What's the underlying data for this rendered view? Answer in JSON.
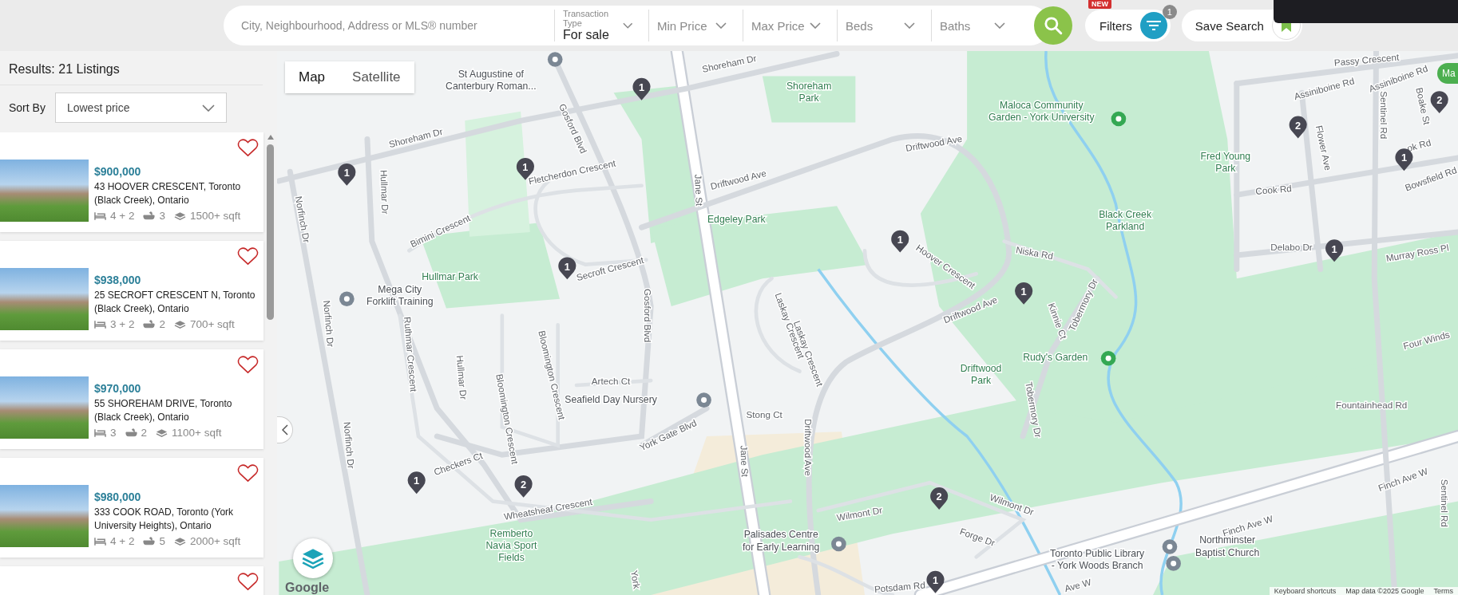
{
  "search": {
    "placeholder": "City, Neighbourhood, Address or MLS® number"
  },
  "filters": [
    {
      "label": "Transaction Type",
      "value": "For sale"
    },
    {
      "placeholder": "Min Price"
    },
    {
      "placeholder": "Max Price"
    },
    {
      "placeholder": "Beds"
    },
    {
      "placeholder": "Baths"
    }
  ],
  "filters_button": {
    "label": "Filters",
    "badge": "NEW",
    "count": "1"
  },
  "save_search_button": {
    "label": "Save Search"
  },
  "results": {
    "title": "Results:  21 Listings",
    "sort_label": "Sort By",
    "sort_value": "Lowest price"
  },
  "listings": [
    {
      "price": "$900,000",
      "address": "43 HOOVER CRESCENT, Toronto (Black Creek), Ontario",
      "beds": "4 + 2",
      "baths": "3",
      "size": "1500+ sqft",
      "favorite": false
    },
    {
      "price": "$938,000",
      "address": "25 SECROFT CRESCENT N, Toronto (Black Creek), Ontario",
      "beds": "3 + 2",
      "baths": "2",
      "size": "700+ sqft",
      "favorite": false
    },
    {
      "price": "$970,000",
      "address": "55 SHOREHAM DRIVE, Toronto (Black Creek), Ontario",
      "beds": "3",
      "baths": "2",
      "size": "1100+ sqft",
      "favorite": false
    },
    {
      "price": "$980,000",
      "address": "333 COOK ROAD, Toronto (York University Heights), Ontario",
      "beds": "4 + 2",
      "baths": "5",
      "size": "2000+ sqft",
      "favorite": false
    },
    {
      "favorite": false
    }
  ],
  "map": {
    "tabs": [
      {
        "label": "Map",
        "selected": true
      },
      {
        "label": "Satellite",
        "selected": false
      }
    ],
    "labels": [
      {
        "kind": "poi",
        "lines": [
          "St Augustine of",
          "Canterbury Roman..."
        ]
      },
      {
        "kind": "street",
        "lines": [
          "Shoreham Dr"
        ]
      },
      {
        "kind": "park",
        "lines": [
          "Shoreham",
          "Park"
        ]
      },
      {
        "kind": "park",
        "lines": [
          "Maloca Community",
          "Garden - York University"
        ]
      },
      {
        "kind": "street",
        "lines": [
          "Passy Crescent"
        ]
      },
      {
        "kind": "street",
        "lines": [
          "Assiniboine Rd"
        ]
      },
      {
        "kind": "street",
        "lines": [
          "Assiniboine Rd"
        ]
      },
      {
        "kind": "street",
        "lines": [
          "Boake St"
        ]
      },
      {
        "kind": "street",
        "lines": [
          "Sentinel Rd"
        ]
      },
      {
        "kind": "street",
        "lines": [
          "Shoreham Dr"
        ]
      },
      {
        "kind": "street",
        "lines": [
          "Fletcherdon Crescent"
        ]
      },
      {
        "kind": "street",
        "lines": [
          "Gosford Blvd"
        ]
      },
      {
        "kind": "street",
        "lines": [
          "Jane St"
        ]
      },
      {
        "kind": "street",
        "lines": [
          "Driftwood Ave"
        ]
      },
      {
        "kind": "street",
        "lines": [
          "Driftwood Ave"
        ]
      },
      {
        "kind": "park",
        "lines": [
          "Fred Young",
          "Park"
        ]
      },
      {
        "kind": "street",
        "lines": [
          "Flower Ave"
        ]
      },
      {
        "kind": "street",
        "lines": [
          "ok Rd"
        ]
      },
      {
        "kind": "street",
        "lines": [
          "Cook Rd"
        ]
      },
      {
        "kind": "street",
        "lines": [
          "Bowsfield Rd"
        ]
      },
      {
        "kind": "street",
        "lines": [
          "Hullmar Dr"
        ]
      },
      {
        "kind": "street",
        "lines": [
          "Norfinch Dr"
        ]
      },
      {
        "kind": "street",
        "lines": [
          "Bimini Crescent"
        ]
      },
      {
        "kind": "park",
        "lines": [
          "Edgeley Park"
        ]
      },
      {
        "kind": "park",
        "lines": [
          "Black Creek",
          "Parkland"
        ]
      },
      {
        "kind": "street",
        "lines": [
          "Delabo Dr"
        ]
      },
      {
        "kind": "street",
        "lines": [
          "Murray Ross Pl"
        ]
      },
      {
        "kind": "street",
        "lines": [
          "Niska Rd"
        ]
      },
      {
        "kind": "street",
        "lines": [
          "Hoover Crescent"
        ]
      },
      {
        "kind": "park",
        "lines": [
          "Hullmar Park"
        ]
      },
      {
        "kind": "street",
        "lines": [
          "Secroft Crescent"
        ]
      },
      {
        "kind": "poi",
        "lines": [
          "Mega City",
          "Forklift Training"
        ]
      },
      {
        "kind": "street",
        "lines": [
          "Gosford Blvd"
        ]
      },
      {
        "kind": "street",
        "lines": [
          "Laskay Crescent"
        ]
      },
      {
        "kind": "street",
        "lines": [
          "Laskay Crescent"
        ]
      },
      {
        "kind": "street",
        "lines": [
          "Driftwood Ave"
        ]
      },
      {
        "kind": "street",
        "lines": [
          "Kinnie Ct"
        ]
      },
      {
        "kind": "street",
        "lines": [
          "Tobermory Dr"
        ]
      },
      {
        "kind": "street",
        "lines": [
          "Norfinch Dr"
        ]
      },
      {
        "kind": "street",
        "lines": [
          "Ruthmar Crescent"
        ]
      },
      {
        "kind": "street",
        "lines": [
          "Hullmar Dr"
        ]
      },
      {
        "kind": "street",
        "lines": [
          "Bloomington Crescent"
        ]
      },
      {
        "kind": "street",
        "lines": [
          "Four Winds"
        ]
      },
      {
        "kind": "park",
        "lines": [
          "Rudy's Garden"
        ]
      },
      {
        "kind": "street",
        "lines": [
          "Artech Ct"
        ]
      },
      {
        "kind": "park",
        "lines": [
          "Driftwood",
          "Park"
        ]
      },
      {
        "kind": "poi",
        "lines": [
          "Seafield Day Nursery"
        ]
      },
      {
        "kind": "street",
        "lines": [
          "Bloomington Crescent"
        ]
      },
      {
        "kind": "street",
        "lines": [
          "Fountainhead Rd"
        ]
      },
      {
        "kind": "street",
        "lines": [
          "Stong Ct"
        ]
      },
      {
        "kind": "street",
        "lines": [
          "Tobermory Dr"
        ]
      },
      {
        "kind": "street",
        "lines": [
          "Norfinch Dr"
        ]
      },
      {
        "kind": "street",
        "lines": [
          "York Gate Blvd"
        ]
      },
      {
        "kind": "street",
        "lines": [
          "Jane St"
        ]
      },
      {
        "kind": "street",
        "lines": [
          "Driftwood Ave"
        ]
      },
      {
        "kind": "street",
        "lines": [
          "Checkers Ct"
        ]
      },
      {
        "kind": "street",
        "lines": [
          "Finch Ave W"
        ]
      },
      {
        "kind": "street",
        "lines": [
          "Sentinel Rd"
        ]
      },
      {
        "kind": "street",
        "lines": [
          "Wheatsheaf Crescent"
        ]
      },
      {
        "kind": "street",
        "lines": [
          "Wilmont Dr"
        ]
      },
      {
        "kind": "street",
        "lines": [
          "Wilmont Dr"
        ]
      },
      {
        "kind": "street",
        "lines": [
          "Finch Ave W"
        ]
      },
      {
        "kind": "street",
        "lines": [
          "Forge Dr"
        ]
      },
      {
        "kind": "park",
        "lines": [
          "Remberto",
          "Navia Sport",
          "Fields"
        ]
      },
      {
        "kind": "poi",
        "lines": [
          "Palisades Centre",
          "for Early Learning"
        ]
      },
      {
        "kind": "poi",
        "lines": [
          "Northminster",
          "Baptist Church"
        ]
      },
      {
        "kind": "poi",
        "lines": [
          "Toronto Public Library",
          "- York Woods Branch"
        ]
      },
      {
        "kind": "street",
        "lines": [
          "Potsdam Rd"
        ]
      },
      {
        "kind": "street",
        "lines": [
          "Ave W"
        ]
      },
      {
        "kind": "street",
        "lines": [
          "York"
        ]
      }
    ],
    "markers": [
      {
        "count": "1"
      },
      {
        "count": "1"
      },
      {
        "count": "1"
      },
      {
        "count": "1"
      },
      {
        "count": "1"
      },
      {
        "count": "1"
      },
      {
        "count": "1"
      },
      {
        "count": "2"
      },
      {
        "count": "2"
      },
      {
        "count": "1"
      },
      {
        "count": "2"
      },
      {
        "count": "1"
      },
      {
        "count": "1"
      },
      {
        "count": "2"
      }
    ],
    "cluster": {
      "label": "Ma"
    },
    "logo": "Google",
    "attribution": [
      "Keyboard shortcuts",
      "Map data ©2025 Google",
      "Terms"
    ]
  }
}
